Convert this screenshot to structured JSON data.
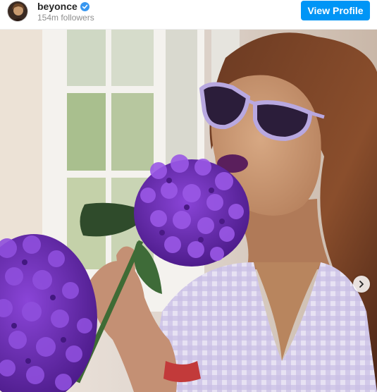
{
  "header": {
    "username": "beyonce",
    "followers": "154m followers",
    "view_profile_label": "View Profile",
    "verified": true
  },
  "post": {
    "image_description": "woman in lavender cat-eye sunglasses holding purple hydrangea flowers near a window",
    "carousel_next_icon": "chevron-right-icon"
  },
  "colors": {
    "accent": "#0095f6",
    "verified_badge": "#3897f0",
    "hydrangea": "#6a2bb0",
    "sunglasses": "#b8a8e0"
  }
}
